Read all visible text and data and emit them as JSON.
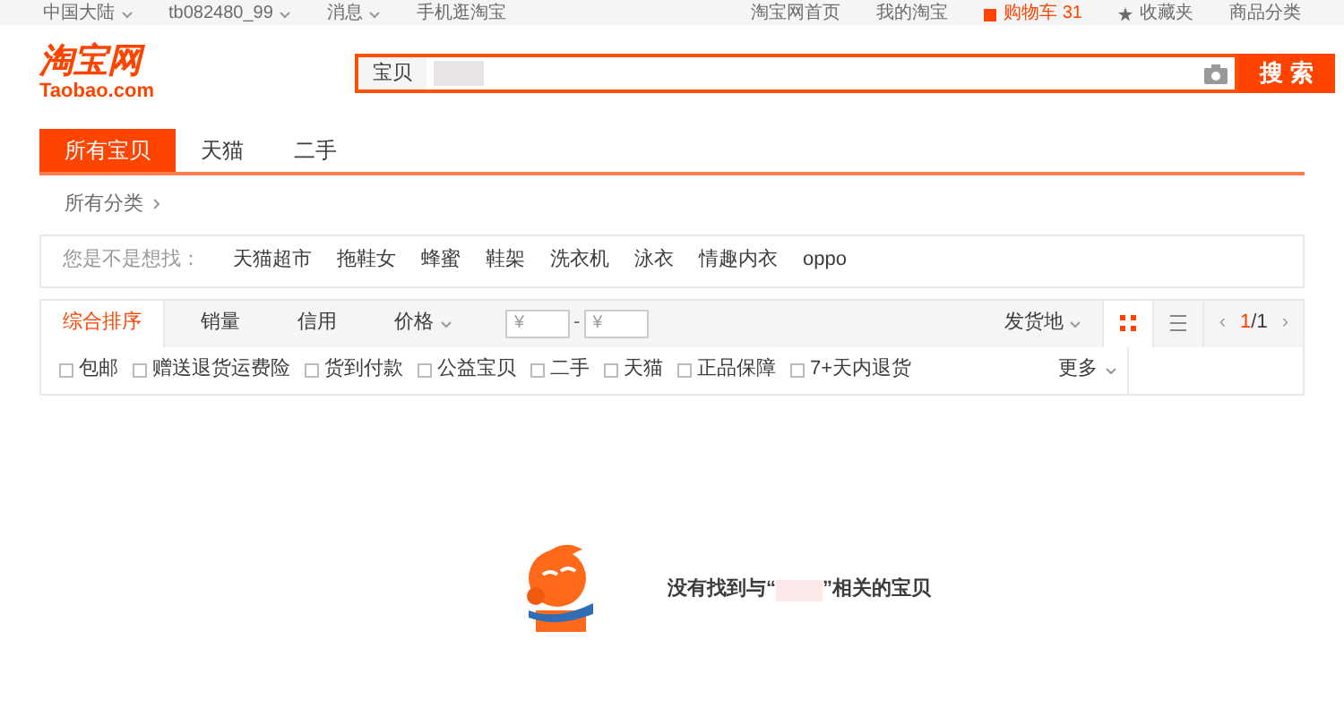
{
  "top_bar": {
    "left": [
      {
        "label": "中国大陆",
        "dropdown": true
      },
      {
        "label": "tb082480_99",
        "dropdown": true
      },
      {
        "label": "消息",
        "dropdown": true
      },
      {
        "label": "手机逛淘宝",
        "dropdown": false
      }
    ],
    "right": [
      {
        "label": "淘宝网首页",
        "kind": "link"
      },
      {
        "label": "我的淘宝",
        "kind": "menu"
      },
      {
        "label": "购物车",
        "count": "31",
        "kind": "cart"
      },
      {
        "label": "收藏夹",
        "kind": "fav"
      },
      {
        "label": "商品分类",
        "kind": "link"
      }
    ]
  },
  "logo": {
    "title": "淘宝网",
    "subtitle": "Taobao.com"
  },
  "search": {
    "scope": "宝贝",
    "button": "搜 索"
  },
  "tabs": [
    {
      "label": "所有宝贝",
      "selected": true
    },
    {
      "label": "天猫",
      "selected": false
    },
    {
      "label": "二手",
      "selected": false
    }
  ],
  "breadcrumb": "所有分类",
  "suggestions": {
    "label": "您是不是想找：",
    "items": [
      "天猫超市",
      "拖鞋女",
      "蜂蜜",
      "鞋架",
      "洗衣机",
      "泳衣",
      "情趣内衣",
      "oppo"
    ]
  },
  "sort": [
    {
      "label": "综合排序",
      "selected": true,
      "dropdown": false
    },
    {
      "label": "销量",
      "selected": false,
      "dropdown": false
    },
    {
      "label": "信用",
      "selected": false,
      "dropdown": false
    },
    {
      "label": "价格",
      "selected": false,
      "dropdown": true
    }
  ],
  "price": {
    "min_placeholder": "¥",
    "max_placeholder": "¥",
    "separator": "-"
  },
  "location": "发货地",
  "view": [
    {
      "kind": "grid",
      "selected": true
    },
    {
      "kind": "list",
      "selected": false
    }
  ],
  "pager": {
    "prev": "‹",
    "current": "1",
    "total": "/1",
    "next": "›"
  },
  "filters": [
    {
      "label": "包邮",
      "checked": false
    },
    {
      "label": "赠送退货运费险",
      "checked": false
    },
    {
      "label": "货到付款",
      "checked": false
    },
    {
      "label": "公益宝贝",
      "checked": false
    },
    {
      "label": "二手",
      "checked": false
    },
    {
      "label": "天猫",
      "checked": false
    },
    {
      "label": "正品保障",
      "checked": false
    },
    {
      "label": "7+天内退货",
      "checked": false
    }
  ],
  "more": "更多",
  "empty": {
    "before": "没有找到与“",
    "after": "”相关的宝贝"
  }
}
